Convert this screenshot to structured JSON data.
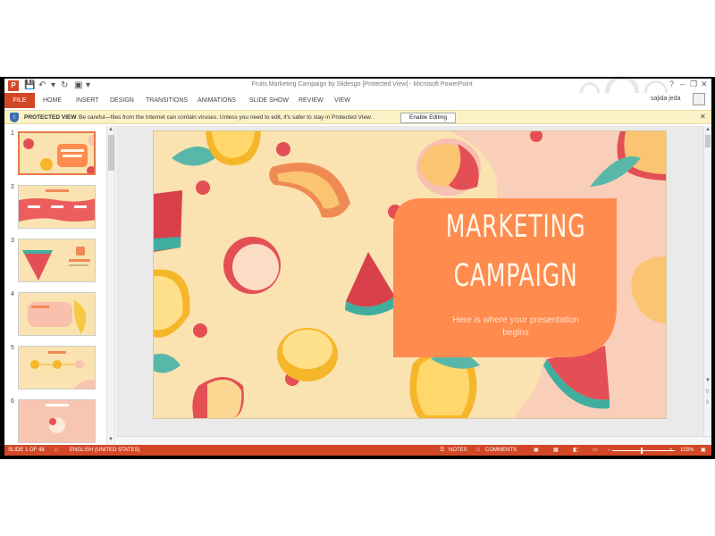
{
  "app": {
    "logo": "P",
    "title": "Fruits Marketing Campaign by Slidesgo [Protected View] - Microsoft PowerPoint",
    "window_controls": [
      "?",
      "–",
      "❐",
      "✕"
    ],
    "user": "sajida jeda"
  },
  "ribbon": {
    "file_label": "FILE",
    "tabs": [
      "HOME",
      "INSERT",
      "DESIGN",
      "TRANSITIONS",
      "ANIMATIONS",
      "SLIDE SHOW",
      "REVIEW",
      "VIEW"
    ]
  },
  "protected_view": {
    "title": "PROTECTED VIEW",
    "message": "Be careful—files from the Internet can contain viruses. Unless you need to edit, it's safer to stay in Protected View.",
    "button": "Enable Editing",
    "close": "✕"
  },
  "thumbnails": {
    "numbers": [
      "1",
      "2",
      "3",
      "4",
      "5",
      "6"
    ],
    "selected_index": 0
  },
  "slide": {
    "title_line1": "MARKETING",
    "title_line2": "CAMPAIGN",
    "subtitle": "Here is where your presentation begins",
    "colors": {
      "background": "#fae3b1",
      "panel": "#ff8b4f",
      "pink": "#f7c5b0",
      "watermelon": "#e44f55",
      "rind": "#3fae9f",
      "lemon": "#f6b62a",
      "leaf": "#58b7a8"
    }
  },
  "status": {
    "slide_of": "SLIDE 1 OF 48",
    "language": "ENGLISH (UNITED STATES)",
    "notes": "NOTES",
    "comments": "COMMENTS",
    "zoom": "103%"
  }
}
